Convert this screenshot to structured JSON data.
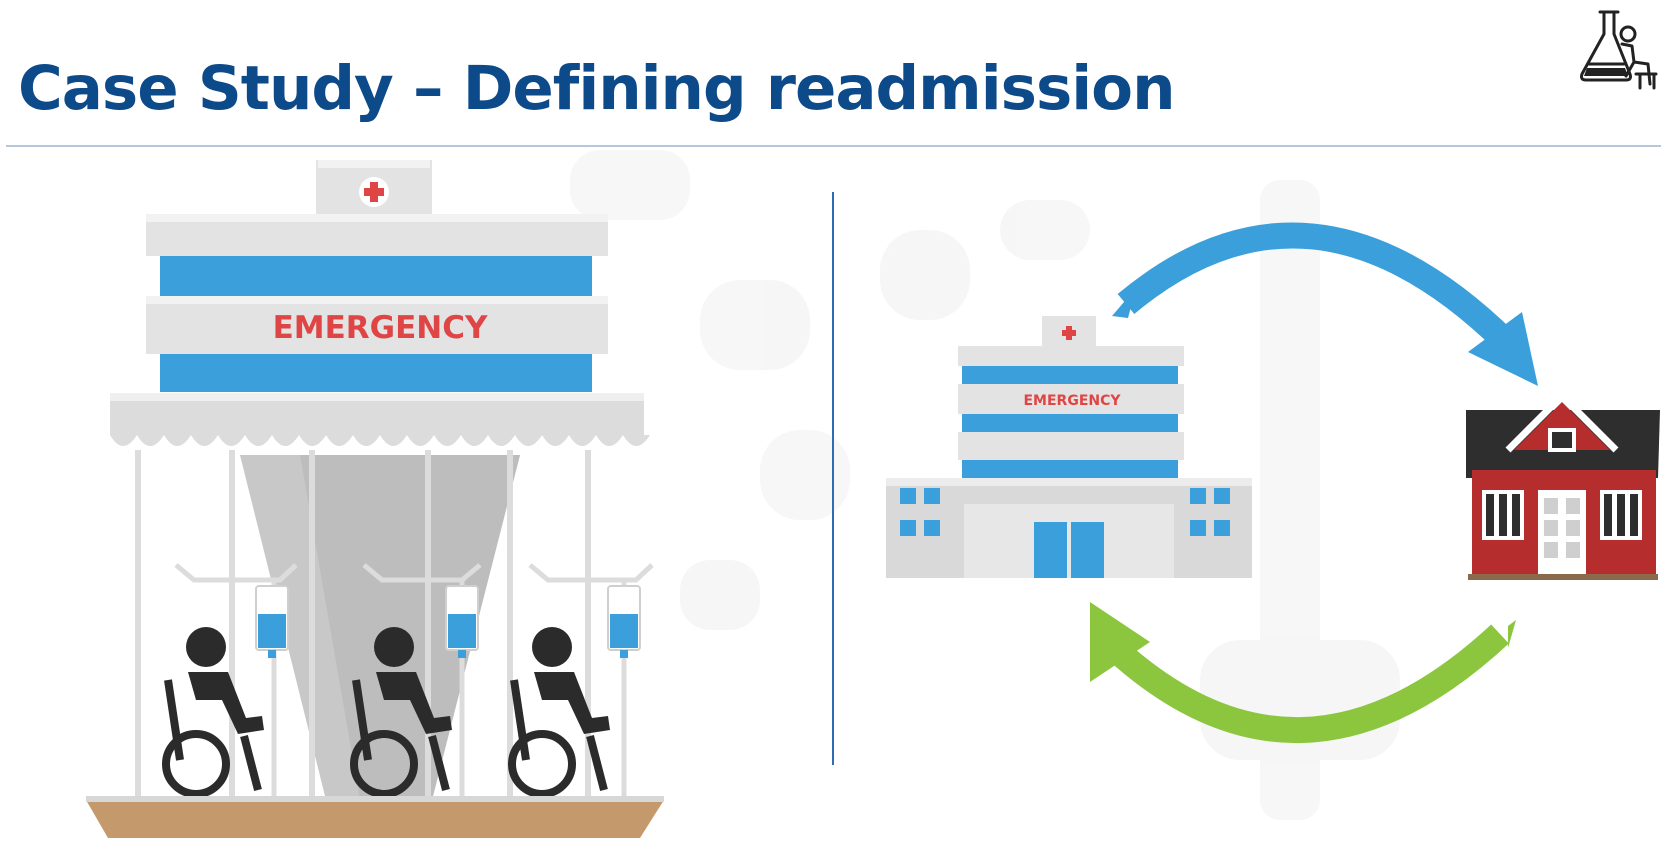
{
  "slide": {
    "title": "Case Study – Defining readmission",
    "logo_icon": "lab-flask-person-icon"
  },
  "left_illustration": {
    "sign_text": "EMERGENCY",
    "icon": "emergency-room-wheelchairs-illustration",
    "patients_count": 3
  },
  "right_illustration": {
    "hospital_sign_text": "EMERGENCY",
    "hospital_icon": "hospital-building-icon",
    "home_icon": "house-icon",
    "discharge_arrow_icon": "arrow-hospital-to-home-icon",
    "readmit_arrow_icon": "arrow-home-to-hospital-icon"
  },
  "colors": {
    "title": "#0d4a8a",
    "hospital_blue": "#3a9fdb",
    "hospital_grey": "#d9d9d9",
    "emergency_red": "#e04545",
    "arrow_blue": "#3a9fdb",
    "arrow_green": "#8cc63f",
    "house_red": "#b52d2d",
    "roof_dark": "#2e2e2e",
    "floor_tan": "#c49a6c",
    "divider": "#2f6db3"
  }
}
